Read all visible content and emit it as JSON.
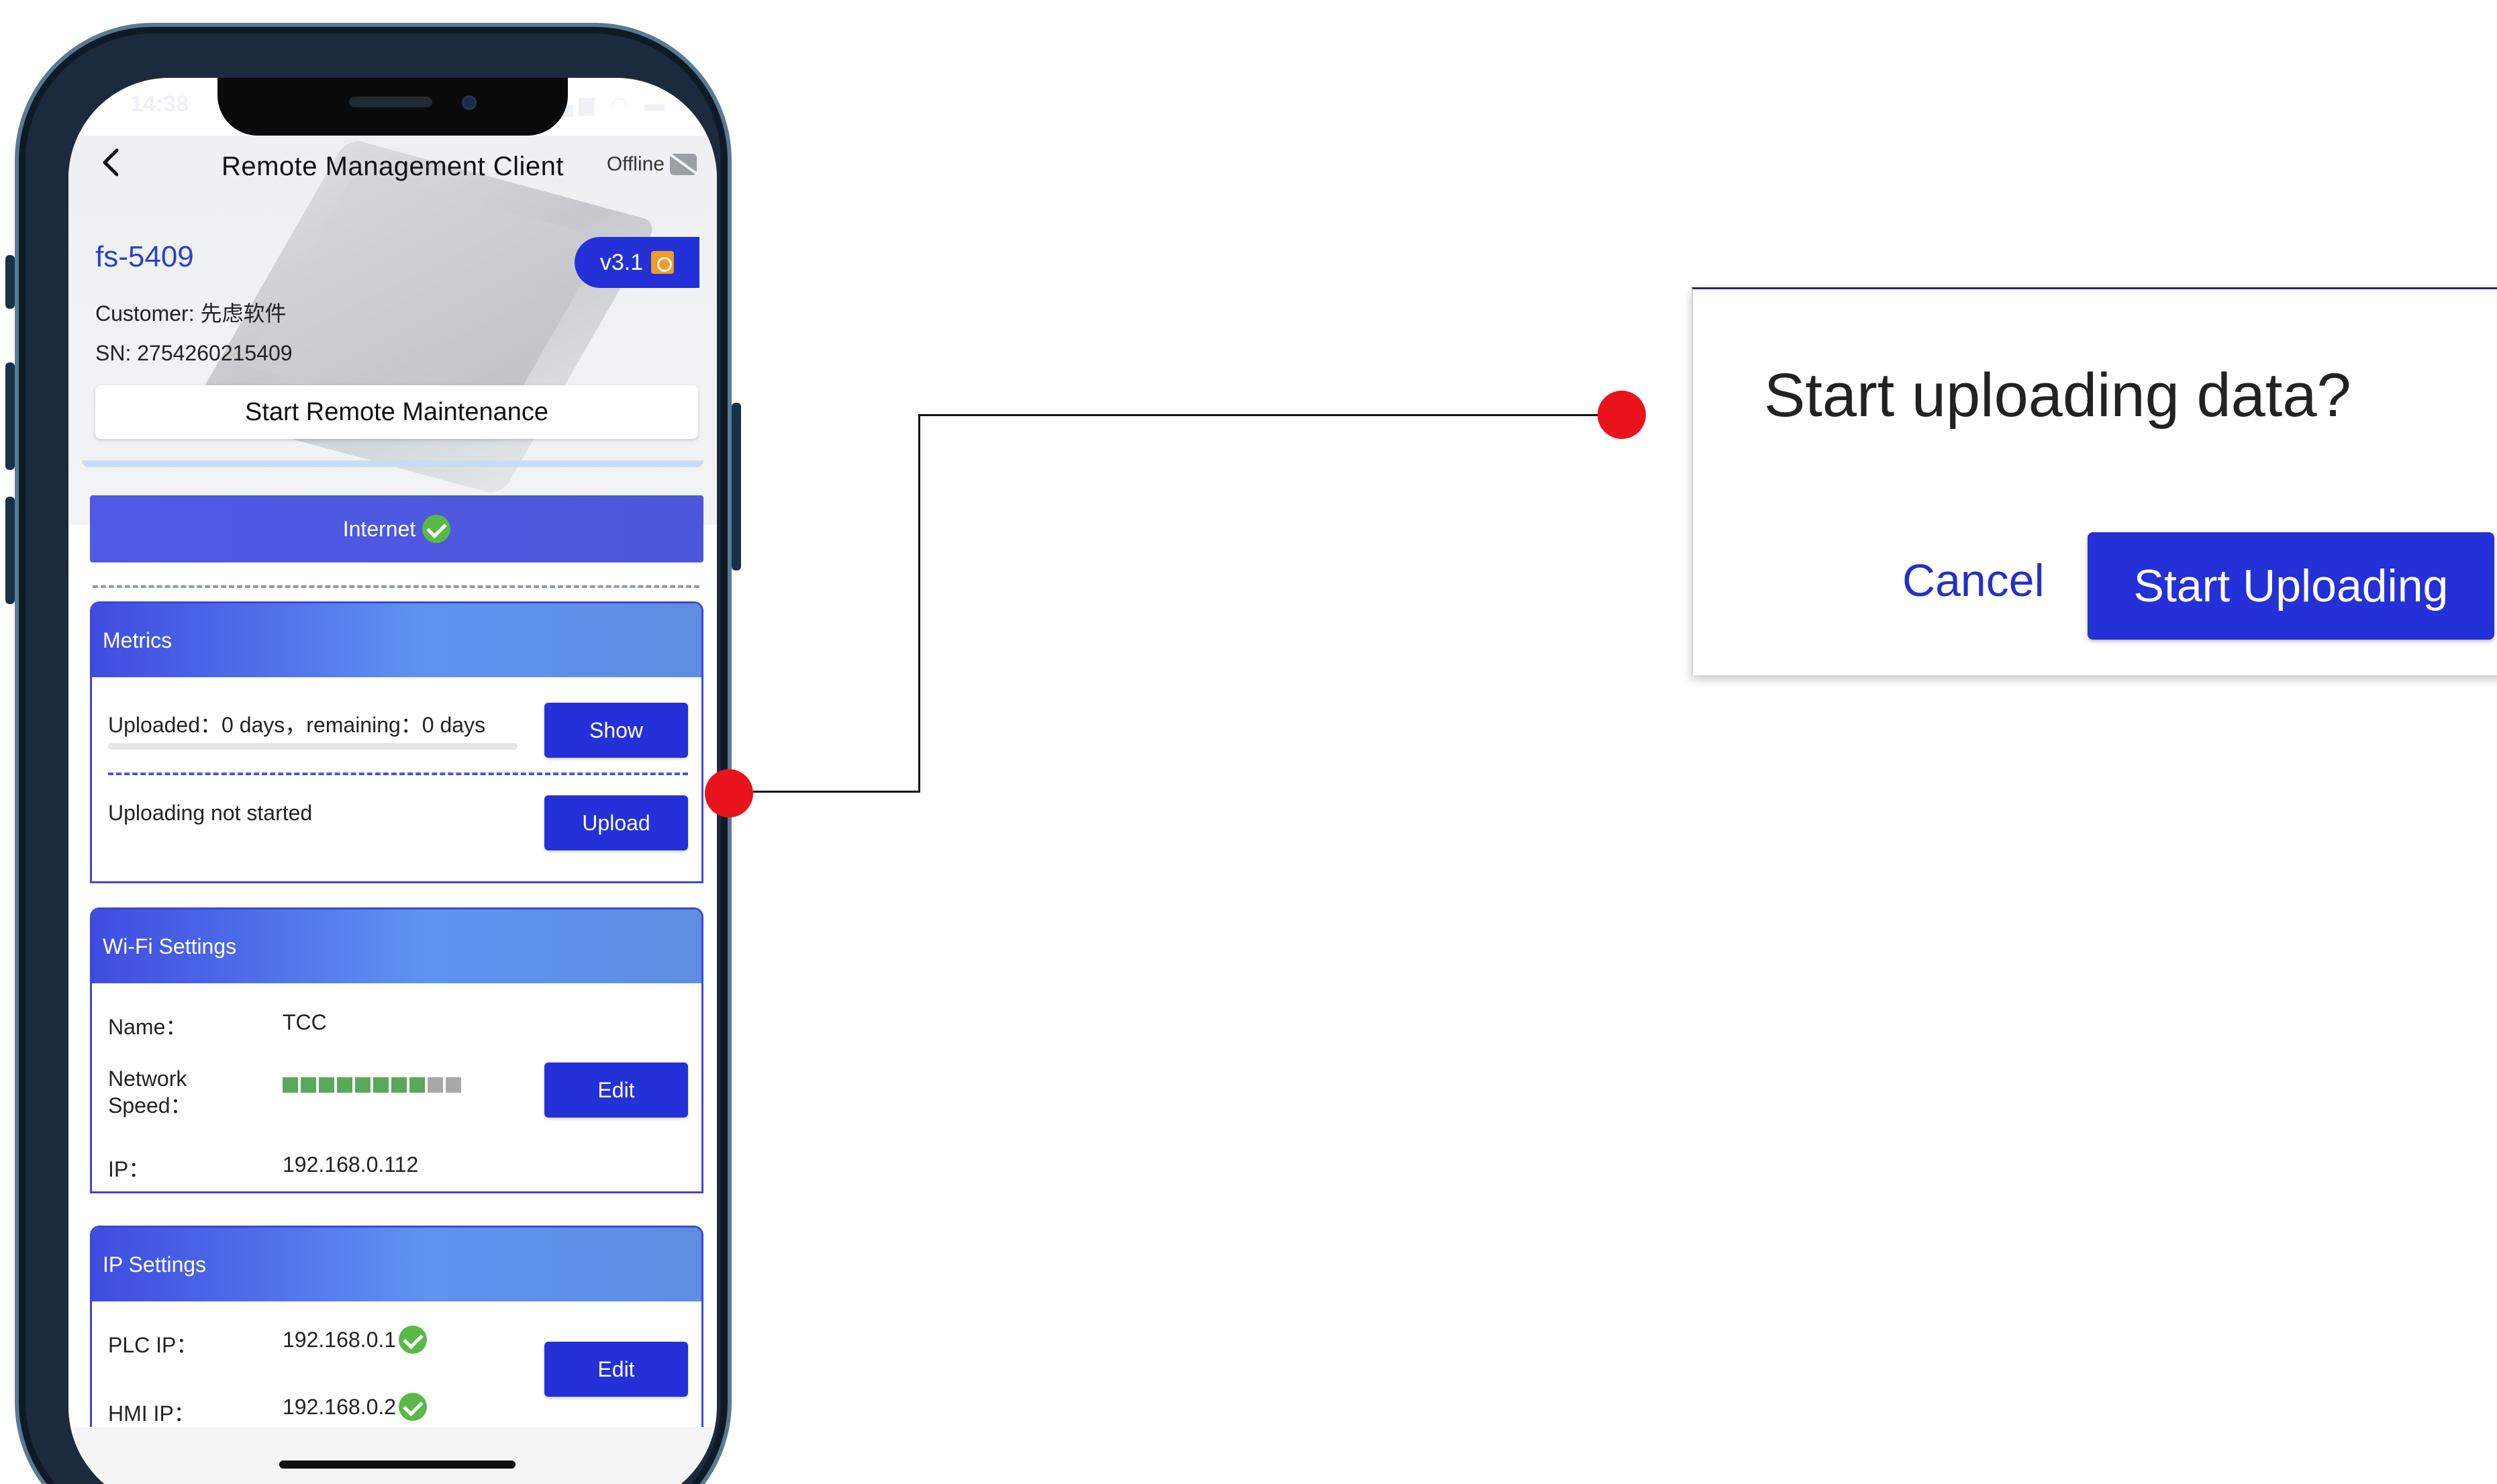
{
  "status_bar": {
    "time": "14:38",
    "icons": "▂▄▆ ◠ ▬"
  },
  "header": {
    "title": "Remote Management Client",
    "offline_label": "Offline",
    "back_icon": "chevron-left-icon",
    "offline_icon": "cloud-off-icon"
  },
  "device": {
    "name": "fs-5409",
    "version": "v3.1",
    "customer": "Customer: 先虑软件",
    "sn": "SN: 2754260215409",
    "maintenance_button": "Start Remote Maintenance"
  },
  "internet": {
    "label": "Internet",
    "connected": true
  },
  "metrics": {
    "title": "Metrics",
    "upload_status": "Uploaded：0 days，remaining：0 days",
    "show_button": "Show",
    "progress": 0,
    "upload_state": "Uploading not started",
    "upload_button": "Upload"
  },
  "wifi": {
    "title": "Wi-Fi Settings",
    "name_label": "Name：",
    "name_value": "TCC",
    "speed_label": "Network Speed：",
    "speed_level": 8,
    "speed_max": 10,
    "ip_label": "IP：",
    "ip_value": "192.168.0.112",
    "edit_button": "Edit"
  },
  "ip_settings": {
    "title": "IP Settings",
    "plc_label": "PLC IP：",
    "plc_value": "192.168.0.1",
    "hmi_label": "HMI IP：",
    "hmi_value": "192.168.0.2",
    "edit_button": "Edit"
  },
  "dialog": {
    "title": "Start uploading data?",
    "cancel": "Cancel",
    "confirm": "Start Uploading"
  },
  "colors": {
    "primary": "#2430d8",
    "callout": "#e8131b",
    "success": "#58b947",
    "speed_on": "#5aa85a",
    "speed_off": "#a8a8a8"
  }
}
